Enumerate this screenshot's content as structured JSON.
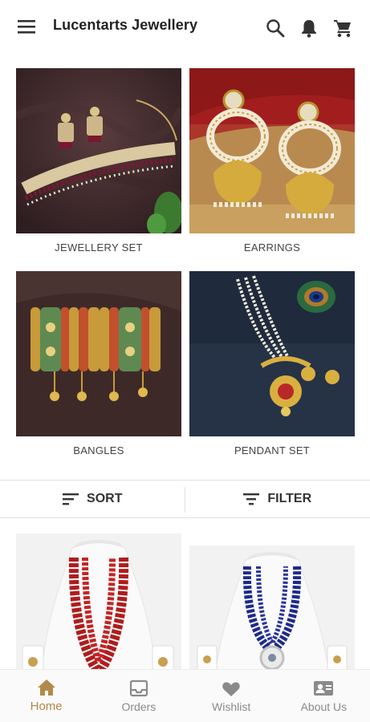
{
  "app": {
    "title": "Lucentarts Jewellery"
  },
  "icons": {
    "menu": "menu-icon",
    "search": "search-icon",
    "notifications": "bell-icon",
    "cart": "cart-icon"
  },
  "categories": [
    {
      "label": "JEWELLERY SET"
    },
    {
      "label": "EARRINGS"
    },
    {
      "label": "BANGLES"
    },
    {
      "label": "PENDANT SET"
    }
  ],
  "toolbar": {
    "sort_label": "SORT",
    "filter_label": "FILTER"
  },
  "bottom_nav": [
    {
      "label": "Home",
      "icon": "home-icon",
      "active": true
    },
    {
      "label": "Orders",
      "icon": "inbox-icon",
      "active": false
    },
    {
      "label": "Wishlist",
      "icon": "heart-icon",
      "active": false
    },
    {
      "label": "About Us",
      "icon": "contact-card-icon",
      "active": false
    }
  ],
  "colors": {
    "accent": "#b28a4a",
    "inactive": "#8a8a8a"
  }
}
